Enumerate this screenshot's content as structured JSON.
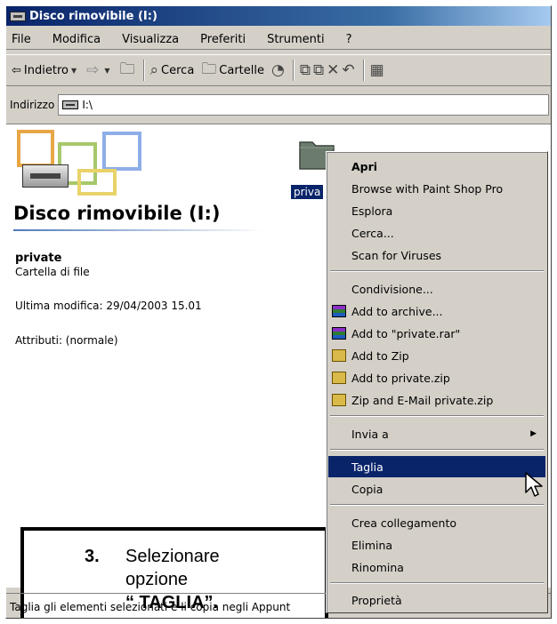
{
  "window": {
    "title": "Disco rimovibile (I:)"
  },
  "menubar": {
    "items": [
      "File",
      "Modifica",
      "Visualizza",
      "Preferiti",
      "Strumenti",
      "?"
    ]
  },
  "toolbar": {
    "back": "Indietro",
    "search": "Cerca",
    "folders": "Cartelle"
  },
  "address": {
    "label": "Indirizzo",
    "value": "I:\\"
  },
  "panel": {
    "title": "Disco rimovibile (I:)",
    "item_name": "private",
    "item_type": "Cartella di file",
    "modified": "Ultima modifica: 29/04/2003 15.01",
    "attributes": "Attributi: (normale)"
  },
  "folder": {
    "label": "priva"
  },
  "context_menu": {
    "items": [
      "Apri",
      "Browse with Paint Shop Pro",
      "Esplora",
      "Cerca...",
      "Scan for Viruses",
      "Condivisione...",
      "Add to archive...",
      "Add to \"private.rar\"",
      "Add to Zip",
      "Add to private.zip",
      "Zip and E-Mail private.zip",
      "Invia a",
      "Taglia",
      "Copia",
      "Crea collegamento",
      "Elimina",
      "Rinomina",
      "Proprietà"
    ]
  },
  "callout": {
    "number": "3.",
    "line1": "Selezionare",
    "line2": "opzione",
    "line3": "“ TAGLIA”."
  },
  "statusbar": {
    "text": "Taglia gli elementi selezionati e li copia negli Appunt"
  },
  "colors": {
    "selection": "#0a246a",
    "window_bg": "#d4d0c8"
  }
}
